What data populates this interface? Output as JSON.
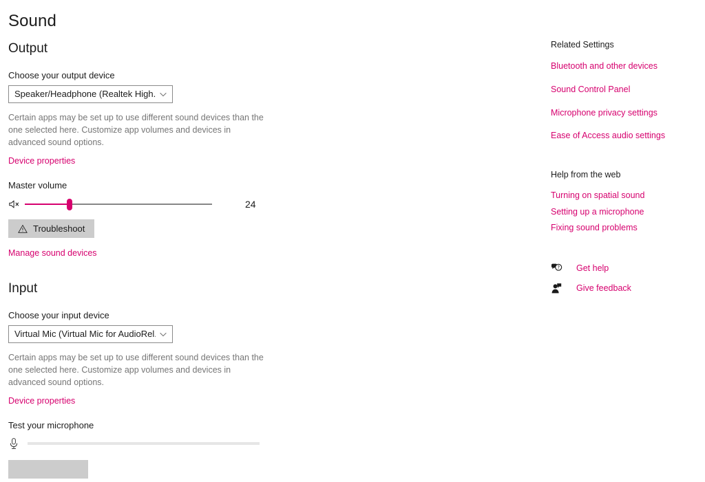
{
  "page": {
    "title": "Sound"
  },
  "output": {
    "heading": "Output",
    "device_label": "Choose your output device",
    "device_value": "Speaker/Headphone (Realtek High...",
    "description": "Certain apps may be set up to use different sound devices than the one selected here. Customize app volumes and devices in advanced sound options.",
    "device_properties_link": "Device properties",
    "volume_label": "Master volume",
    "volume_value": "24",
    "volume_percent": 24,
    "volume_icon": "speaker-muted-icon",
    "troubleshoot_label": "Troubleshoot",
    "troubleshoot_icon": "warning-triangle-icon",
    "manage_devices_link": "Manage sound devices"
  },
  "input": {
    "heading": "Input",
    "device_label": "Choose your input device",
    "device_value": "Virtual Mic (Virtual Mic for AudioRel...",
    "description": "Certain apps may be set up to use different sound devices than the one selected here. Customize app volumes and devices in advanced sound options.",
    "device_properties_link": "Device properties",
    "test_label": "Test your microphone",
    "test_icon": "microphone-icon",
    "test_level_percent": 0
  },
  "related_settings": {
    "heading": "Related Settings",
    "links": [
      "Bluetooth and other devices",
      "Sound Control Panel",
      "Microphone privacy settings",
      "Ease of Access audio settings"
    ]
  },
  "help_web": {
    "heading": "Help from the web",
    "links": [
      "Turning on spatial sound",
      "Setting up a microphone",
      "Fixing sound problems"
    ]
  },
  "support": {
    "items": [
      {
        "label": "Get help",
        "icon": "help-bubble-icon"
      },
      {
        "label": "Give feedback",
        "icon": "feedback-person-icon"
      }
    ]
  },
  "colors": {
    "accent": "#d6006e",
    "text": "#1b1b1b",
    "muted_text": "#767676",
    "button_bg": "#cccccc",
    "track": "#868686"
  }
}
